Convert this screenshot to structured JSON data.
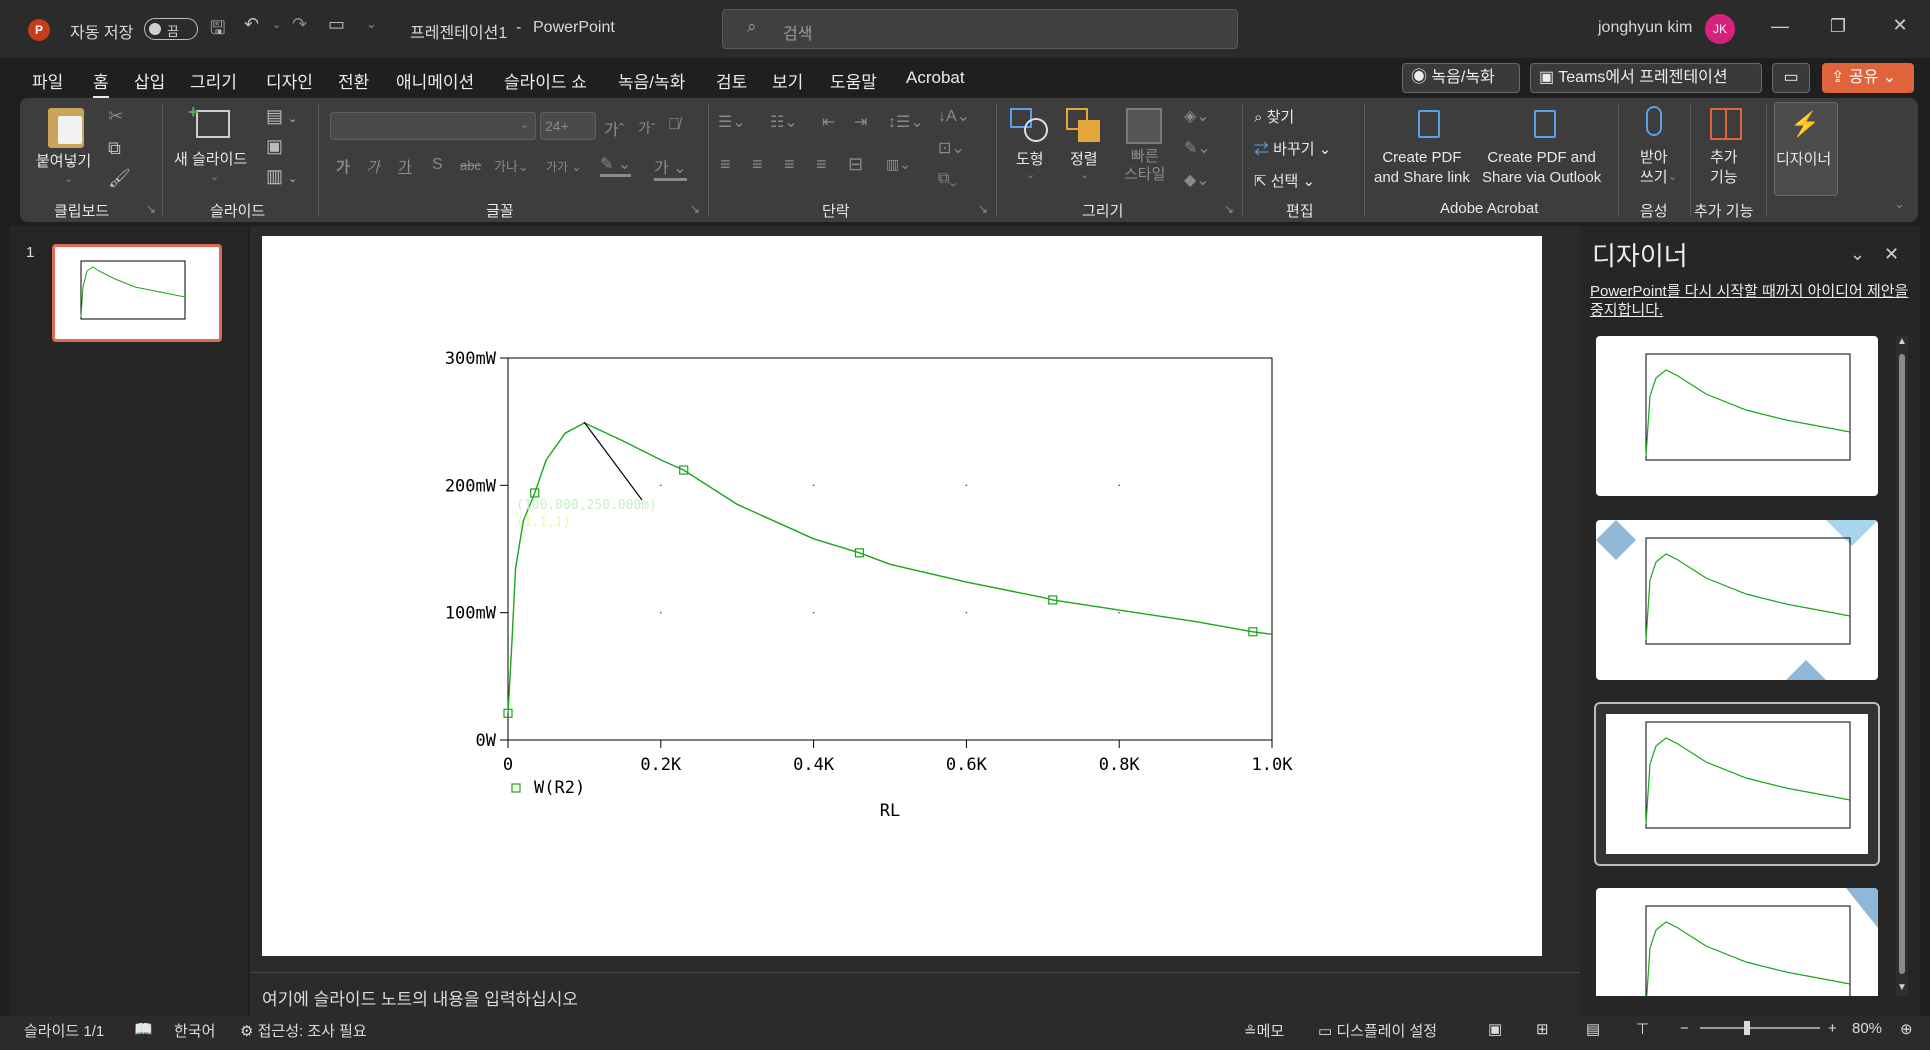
{
  "titlebar": {
    "app_icon": "powerpoint-icon",
    "autosave_label": "자동 저장",
    "autosave_toggle": "끔",
    "doc_title": "프레젠테이션1",
    "separator": "-",
    "app_name": "PowerPoint",
    "search_placeholder": "검색",
    "user_name": "jonghyun kim",
    "user_initials": "JK"
  },
  "tabs": [
    "파일",
    "홈",
    "삽입",
    "그리기",
    "디자인",
    "전환",
    "애니메이션",
    "슬라이드 쇼",
    "녹음/녹화",
    "검토",
    "보기",
    "도움말",
    "Acrobat"
  ],
  "active_tab": "홈",
  "top_buttons": {
    "record": "녹음/녹화",
    "teams": "Teams에서 프레젠테이션",
    "share": "공유"
  },
  "ribbon": {
    "paste": "붙여넣기",
    "new_slide": "새 슬라이드",
    "font_size": "24+",
    "shapes": "도형",
    "arrange": "정렬",
    "quick_styles": "빠른\n스타일",
    "find": "찾기",
    "replace": "바꾸기",
    "select": "선택",
    "create_pdf_link": "Create PDF\nand Share link",
    "create_pdf_outlook": "Create PDF and\nShare via Outlook",
    "dictate": "받아\n쓰기",
    "addins": "추가\n기능",
    "designer": "디자이너",
    "groups": {
      "clipboard": "클립보드",
      "slides": "슬라이드",
      "font": "글꼴",
      "paragraph": "단락",
      "drawing": "그리기",
      "editing": "편집",
      "acrobat": "Adobe Acrobat",
      "voice": "음성",
      "addins": "추가 기능"
    }
  },
  "slide_panel": {
    "slide_number": "1"
  },
  "notes_placeholder": "여기에 슬라이드 노트의 내용을 입력하십시오",
  "designer": {
    "title": "디자이너",
    "link_text": "PowerPoint를 다시 시작할 때까지 아이디어 제안을 중지합니다."
  },
  "statusbar": {
    "slide_info": "슬라이드 1/1",
    "language": "한국어",
    "accessibility": "접근성: 조사 필요",
    "notes": "메모",
    "display_settings": "디스플레이 설정",
    "zoom": "80%"
  },
  "chart_data": {
    "type": "line",
    "title": "",
    "xlabel": "RL",
    "ylabel": "",
    "x_ticks": [
      "0",
      "0.2K",
      "0.4K",
      "0.6K",
      "0.8K",
      "1.0K"
    ],
    "y_ticks": [
      "0W",
      "100mW",
      "200mW",
      "300mW"
    ],
    "xlim": [
      0,
      1000
    ],
    "ylim": [
      0,
      300
    ],
    "grid": "dotted",
    "legend": "bottom-left",
    "series": [
      {
        "name": "W(R2)",
        "color": "#1aa51a",
        "x": [
          0,
          5,
          10,
          20,
          35,
          50,
          75,
          100,
          150,
          200,
          230,
          300,
          400,
          460,
          500,
          600,
          700,
          713,
          800,
          900,
          975,
          1000
        ],
        "y": [
          21,
          75,
          135,
          172,
          194,
          220,
          241,
          249,
          235,
          220,
          212,
          185,
          158,
          147,
          138,
          124,
          112,
          110,
          102,
          93,
          85,
          83
        ]
      }
    ],
    "markers_x": [
      0,
      35,
      230,
      460,
      713,
      975
    ],
    "markers_y": [
      21,
      194,
      212,
      147,
      110,
      85
    ],
    "annotation": {
      "text": "(100.000,250.000m)",
      "text_faded": "(100.000,250.000m)"
    }
  }
}
